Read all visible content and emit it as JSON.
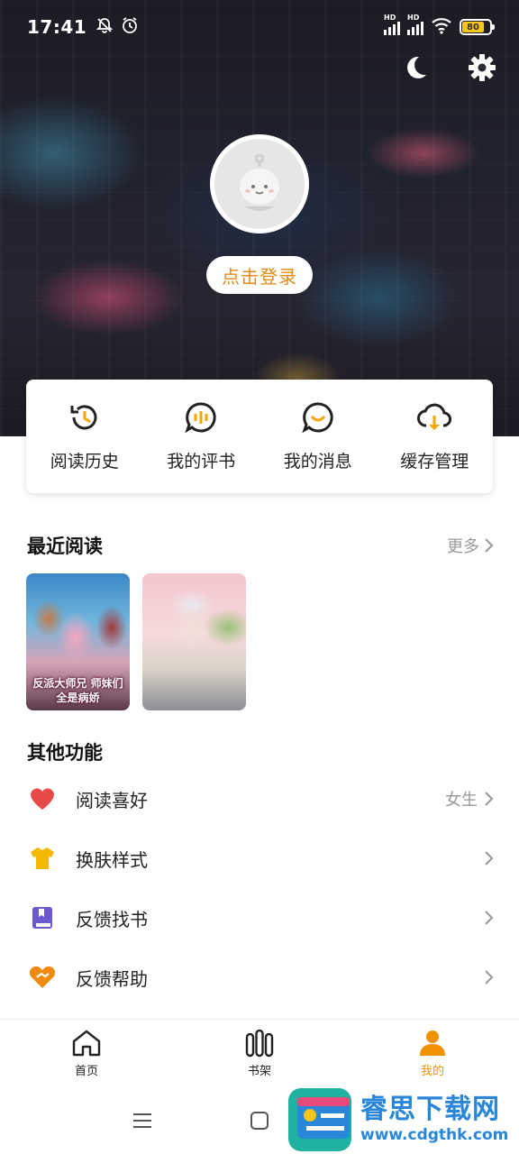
{
  "status_bar": {
    "time": "17:41",
    "battery": "80",
    "hd": "HD"
  },
  "profile": {
    "login_label": "点击登录"
  },
  "quick_actions": [
    {
      "label": "阅读历史",
      "icon": "history-icon"
    },
    {
      "label": "我的评书",
      "icon": "comment-icon"
    },
    {
      "label": "我的消息",
      "icon": "message-icon"
    },
    {
      "label": "缓存管理",
      "icon": "cloud-download-icon"
    }
  ],
  "recent": {
    "title": "最近阅读",
    "more_label": "更多",
    "books": [
      {
        "cover_text": "反派大师兄 师妹们全是病娇"
      },
      {
        "cover_text": ""
      }
    ]
  },
  "other": {
    "title": "其他功能",
    "items": [
      {
        "label": "阅读喜好",
        "value": "女生",
        "icon": "heart-icon"
      },
      {
        "label": "换肤样式",
        "value": "",
        "icon": "tshirt-icon"
      },
      {
        "label": "反馈找书",
        "value": "",
        "icon": "book-icon"
      },
      {
        "label": "反馈帮助",
        "value": "",
        "icon": "help-icon"
      }
    ]
  },
  "tabbar": [
    {
      "label": "首页",
      "active": false
    },
    {
      "label": "书架",
      "active": false
    },
    {
      "label": "我的",
      "active": true
    }
  ],
  "watermark": {
    "title": "睿思下载网",
    "url": "www.cdgthk.com"
  },
  "colors": {
    "accent": "#f29100",
    "login_text": "#e58a13",
    "heart": "#e84a4a",
    "tshirt": "#f5b800",
    "book": "#6a5acd",
    "help": "#f08a10",
    "watermark": "#2a86d8"
  }
}
